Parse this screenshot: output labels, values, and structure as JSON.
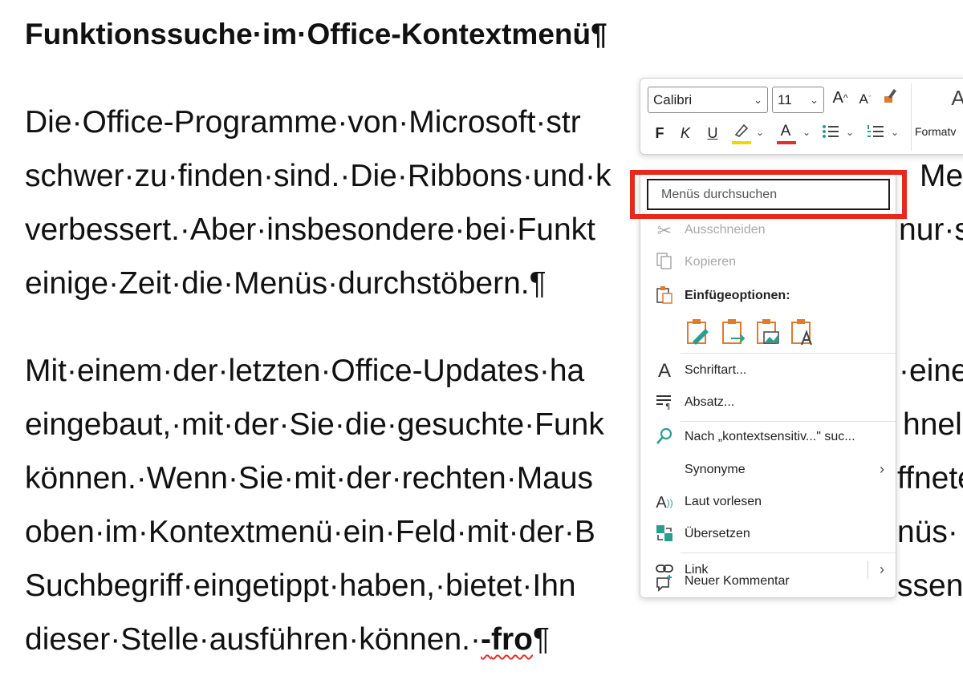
{
  "document": {
    "heading": "Funktionssuche·im·Office-Kontextmenü¶",
    "lines": [
      "Die·Office-Programme·von·Microsoft·str",
      "schwer·zu·finden·sind.·Die·Ribbons·und·k",
      "verbessert.·Aber·insbesondere·bei·Funkt",
      "einige·Zeit·die·Menüs·durchstöbern.¶",
      "Mit·einem·der·letzten·Office-Updates·ha",
      "eingebaut,·mit·der·Sie·die·gesuchte·Funk",
      "können.·Wenn·Sie·mit·der·rechten·Maus",
      "oben·im·Kontextmenü·ein·Feld·mit·der·B",
      "Suchbegriff·eingetippt·haben,·bietet·Ihn",
      "dieser·Stelle·ausführen·können.·"
    ],
    "right_fragments": [
      "Me",
      "nur·s",
      "·eine",
      "hnel",
      "ffnete",
      "nüs·",
      "ssend"
    ],
    "last_dash": "-",
    "last_bold": "fro",
    "last_pilcrow": "¶"
  },
  "mini_toolbar": {
    "font_name": "Calibri",
    "font_size": "11",
    "grow_icon": "font-grow-icon",
    "shrink_icon": "font-shrink-icon",
    "format_painter_icon": "format-painter-icon",
    "bold": "F",
    "italic": "K",
    "underline": "U",
    "highlight_color": "#f2d600",
    "font_color": "#e0302a",
    "styles_label": "Formatv",
    "styles_glyph": "A"
  },
  "context_menu": {
    "search_placeholder": "Menüs durchsuchen",
    "highlight_color": "#e8271f",
    "items": {
      "cut": "Ausschneiden",
      "copy": "Kopieren",
      "paste_options": "Einfügeoptionen:",
      "font": "Schriftart...",
      "paragraph": "Absatz...",
      "search": "Nach „kontextsensitiv...\" suc...",
      "synonyms": "Synonyme",
      "read_aloud": "Laut vorlesen",
      "translate": "Übersetzen",
      "link": "Link",
      "new_comment": "Neuer Kommentar"
    },
    "icons": {
      "cut": "scissors-icon",
      "copy": "copy-icon",
      "paste": "clipboard-icon",
      "font": "font-icon",
      "paragraph": "paragraph-icon",
      "search": "search-icon",
      "read_aloud": "read-aloud-icon",
      "translate": "translate-icon",
      "link": "link-icon",
      "comment": "comment-icon"
    }
  }
}
